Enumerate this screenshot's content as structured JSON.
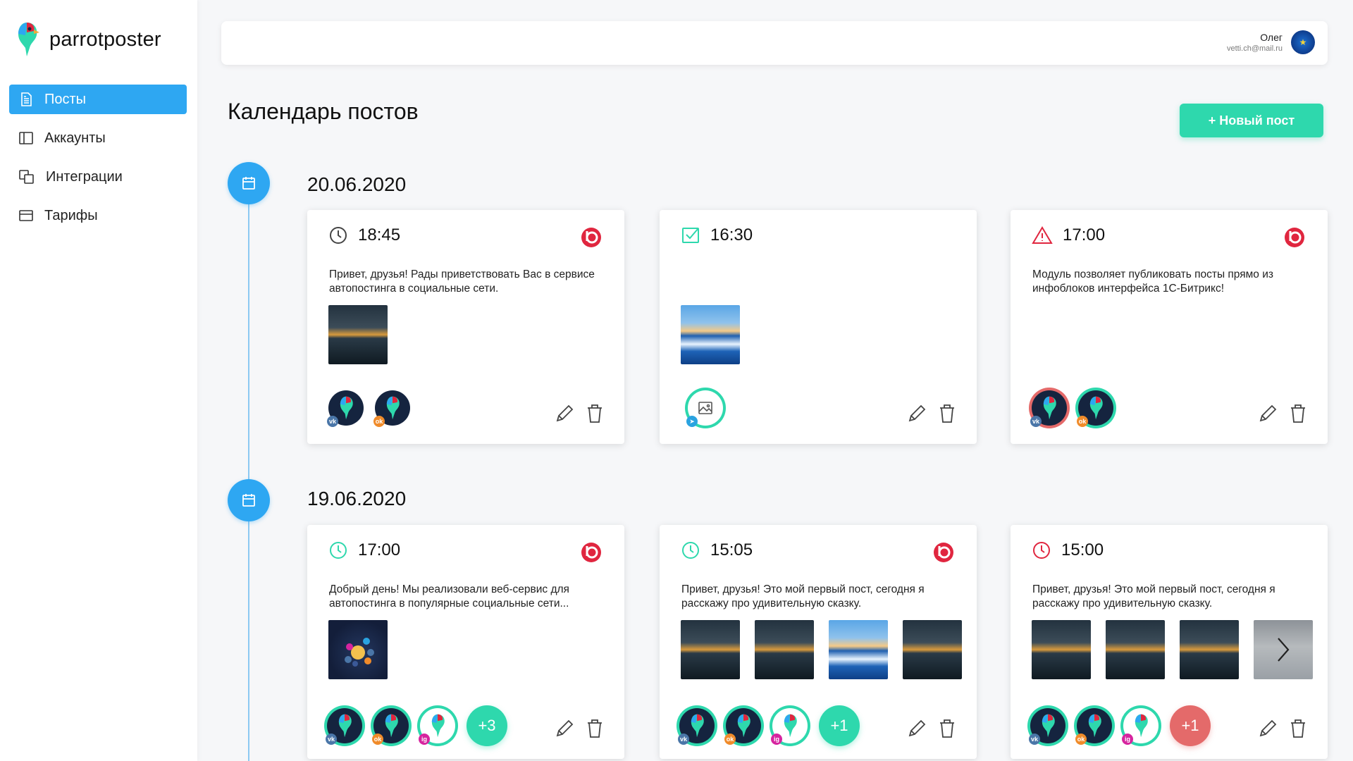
{
  "app": {
    "logo_text": "parrotposter"
  },
  "sidebar": {
    "items": [
      {
        "label": "Посты",
        "active": true,
        "icon": "document-icon"
      },
      {
        "label": "Аккаунты",
        "active": false,
        "icon": "columns-icon"
      },
      {
        "label": "Интеграции",
        "active": false,
        "icon": "copy-icon"
      },
      {
        "label": "Тарифы",
        "active": false,
        "icon": "card-icon"
      }
    ]
  },
  "header": {
    "user_name": "Олег",
    "user_email": "vetti.ch@mail.ru"
  },
  "page": {
    "title": "Календарь постов",
    "new_post_label": "+ Новый пост"
  },
  "colors": {
    "accent_blue": "#2ea7f2",
    "accent_green": "#2ed8ad",
    "accent_red": "#e46a6a",
    "ok_red": "#e0263f"
  },
  "days": [
    {
      "date": "20.06.2020",
      "posts": [
        {
          "time": "18:45",
          "status": "scheduled",
          "text": "Привет, друзья! Рады приветствовать Вас в сервисе автопостинга в социальные сети.",
          "thumbs": [
            "sunset"
          ],
          "accounts": [
            "vk",
            "ok"
          ]
        },
        {
          "time": "16:30",
          "status": "published",
          "text": "",
          "thumbs": [
            "sea"
          ],
          "accounts": [
            "tg"
          ]
        },
        {
          "time": "17:00",
          "status": "error",
          "text": "Модуль позволяет публиковать посты прямо из инфоблоков интерфейса 1С-Битрикс!",
          "thumbs": [],
          "accounts": [
            "vk",
            "ok"
          ]
        }
      ]
    },
    {
      "date": "19.06.2020",
      "posts": [
        {
          "time": "17:00",
          "status": "scheduled",
          "text": "Добрый день! Мы реализовали веб-сервис для автопостинга в популярные социальные сети...",
          "thumbs": [
            "app"
          ],
          "accounts": [
            "vk",
            "ok",
            "ig"
          ],
          "more": "+3"
        },
        {
          "time": "15:05",
          "status": "scheduled",
          "text": "Привет, друзья! Это мой первый пост, сегодня я расскажу про удивительную сказку.",
          "thumbs": [
            "sunset",
            "sunset",
            "sea",
            "sunset"
          ],
          "accounts": [
            "vk",
            "ok",
            "ig"
          ],
          "more": "+1"
        },
        {
          "time": "15:00",
          "status": "overdue",
          "text": "Привет, друзья! Это мой первый пост, сегодня я расскажу про удивительную сказку.",
          "thumbs": [
            "sunset",
            "sunset",
            "sunset",
            "more"
          ],
          "accounts": [
            "vk",
            "ok",
            "ig"
          ],
          "more": "+1"
        }
      ]
    }
  ]
}
